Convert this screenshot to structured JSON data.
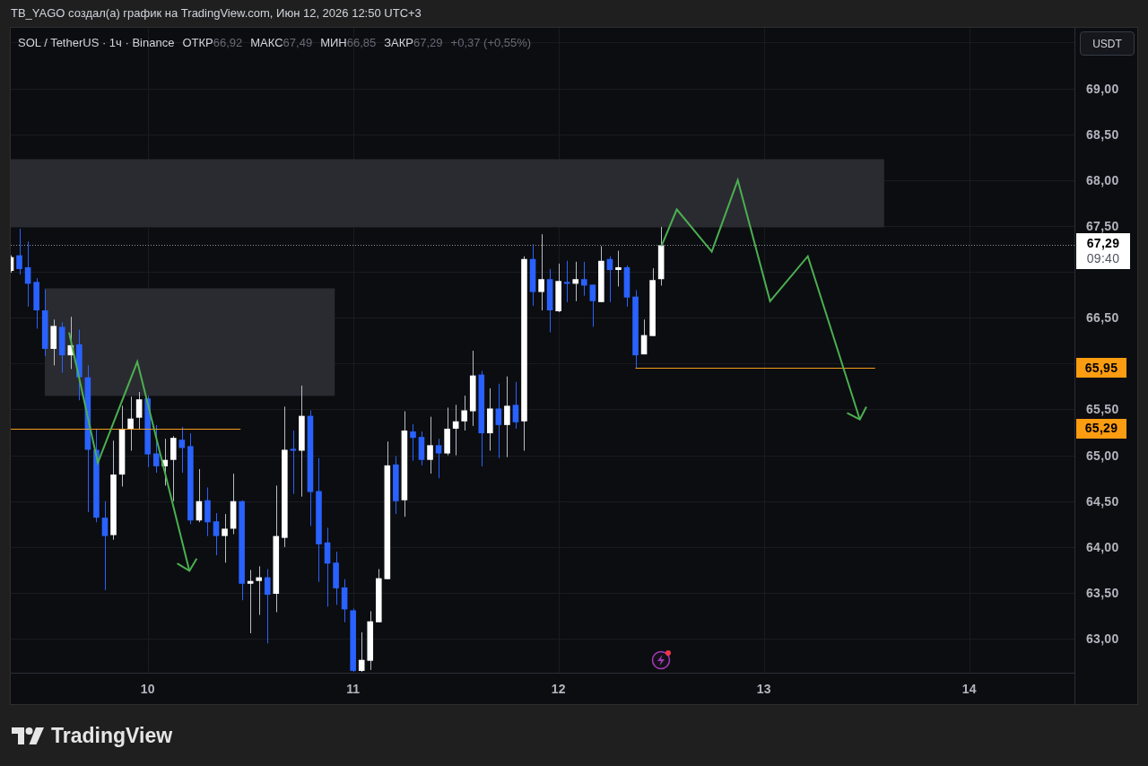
{
  "title": "TB_YAGO создал(а) график на TradingView.com, Июн 12, 2026 12:50 UTC+3",
  "chart": {
    "legend": {
      "symbol": "SOL / TetherUS · 1ч · Binance",
      "fields": [
        {
          "label": "ОТКР",
          "value": "66,92"
        },
        {
          "label": "МАКС",
          "value": "67,49"
        },
        {
          "label": "МИН",
          "value": "66,85"
        },
        {
          "label": "ЗАКР",
          "value": "67,29"
        }
      ],
      "change": "+0,37 (+0,55%)"
    },
    "currency_button": "USDT",
    "last_price_tag": {
      "price": "67,29",
      "countdown": "09:40"
    },
    "level_tags": [
      {
        "price": "65,95"
      },
      {
        "price": "65,29"
      }
    ],
    "drawings": [
      {
        "kind": "zone"
      },
      {
        "kind": "zone"
      },
      {
        "kind": "arrow_path",
        "arrow_head": true
      },
      {
        "kind": "arrow_path",
        "arrow_head": true
      }
    ],
    "chart_data": {
      "type": "candlestick",
      "xlim": [
        9.3333,
        14.5125
      ],
      "ylim": [
        62.63,
        69.66
      ],
      "xticks": [
        {
          "value": 10,
          "label": "10"
        },
        {
          "value": 11,
          "label": "11"
        },
        {
          "value": 12,
          "label": "12"
        },
        {
          "value": 13,
          "label": "13"
        },
        {
          "value": 14,
          "label": "14"
        }
      ],
      "yticks": [
        {
          "value": 63,
          "label": "63,00"
        },
        {
          "value": 63.5,
          "label": "63,50"
        },
        {
          "value": 64,
          "label": "64,00"
        },
        {
          "value": 64.5,
          "label": "64,50"
        },
        {
          "value": 65,
          "label": "65,00"
        },
        {
          "value": 65.5,
          "label": "65,50"
        },
        {
          "value": 66.5,
          "label": "66,50"
        },
        {
          "value": 67.5,
          "label": "67,50"
        },
        {
          "value": 68,
          "label": "68,00"
        },
        {
          "value": 68.5,
          "label": "68,50"
        },
        {
          "value": 69,
          "label": "69,00"
        }
      ],
      "x": [
        9.3333,
        9.375,
        9.4167,
        9.4583,
        9.5,
        9.5417,
        9.5833,
        9.625,
        9.6667,
        9.7083,
        9.75,
        9.7917,
        9.8333,
        9.875,
        9.9167,
        9.9583,
        10,
        10.0417,
        10.0833,
        10.125,
        10.1667,
        10.2083,
        10.25,
        10.2917,
        10.3333,
        10.375,
        10.4167,
        10.4583,
        10.5,
        10.5417,
        10.5833,
        10.625,
        10.6667,
        10.7083,
        10.75,
        10.7917,
        10.8333,
        10.875,
        10.9167,
        10.9583,
        11,
        11.0417,
        11.0833,
        11.125,
        11.1667,
        11.2083,
        11.25,
        11.2917,
        11.3333,
        11.375,
        11.4167,
        11.4583,
        11.5,
        11.5417,
        11.5833,
        11.625,
        11.6667,
        11.7083,
        11.75,
        11.7917,
        11.8333,
        11.875,
        11.9167,
        11.9583,
        12,
        12.0417,
        12.0833,
        12.125,
        12.1667,
        12.2083,
        12.25,
        12.2917,
        12.3333,
        12.375,
        12.4167,
        12.4583,
        12.5
      ],
      "ohlc": [
        [
          67.01,
          67.18,
          66.99,
          67.16
        ],
        [
          67.18,
          67.47,
          66.97,
          67.03
        ],
        [
          67.05,
          67.33,
          66.62,
          66.87
        ],
        [
          66.89,
          66.93,
          66.38,
          66.58
        ],
        [
          66.58,
          66.81,
          66.08,
          66.16
        ],
        [
          66.16,
          66.48,
          65.98,
          66.41
        ],
        [
          66.4,
          66.45,
          65.9,
          66.09
        ],
        [
          66.09,
          66.51,
          65.94,
          66.2
        ],
        [
          66.21,
          66.37,
          65.6,
          65.85
        ],
        [
          65.85,
          65.98,
          64.38,
          65.06
        ],
        [
          65.06,
          65.29,
          64.27,
          64.32
        ],
        [
          64.32,
          64.5,
          63.53,
          64.12
        ],
        [
          64.13,
          65.16,
          64.08,
          64.79
        ],
        [
          64.79,
          65.54,
          64.66,
          65.29
        ],
        [
          65.28,
          65.64,
          65.05,
          65.4
        ],
        [
          65.41,
          65.69,
          65.28,
          65.61
        ],
        [
          65.62,
          65.65,
          64.87,
          65.01
        ],
        [
          65.02,
          65.33,
          64.81,
          64.88
        ],
        [
          64.88,
          65.18,
          64.67,
          64.95
        ],
        [
          64.95,
          65.21,
          64.5,
          65.19
        ],
        [
          65.17,
          65.31,
          64.81,
          65.08
        ],
        [
          65.1,
          65.24,
          64.25,
          64.29
        ],
        [
          64.29,
          64.85,
          64.27,
          64.5
        ],
        [
          64.51,
          64.65,
          64.12,
          64.27
        ],
        [
          64.28,
          64.37,
          63.91,
          64.12
        ],
        [
          64.12,
          64.36,
          63.83,
          64.2
        ],
        [
          64.2,
          64.8,
          64.14,
          64.5
        ],
        [
          64.5,
          64.51,
          63.42,
          63.6
        ],
        [
          63.6,
          63.75,
          63.06,
          63.63
        ],
        [
          63.63,
          63.79,
          63.26,
          63.67
        ],
        [
          63.67,
          63.76,
          62.95,
          63.48
        ],
        [
          63.49,
          64.67,
          63.29,
          64.12
        ],
        [
          64.1,
          65.53,
          64.0,
          65.06
        ],
        [
          65.07,
          65.27,
          64.58,
          65.05
        ],
        [
          65.05,
          65.76,
          64.55,
          65.43
        ],
        [
          65.43,
          65.49,
          64.23,
          64.6
        ],
        [
          64.61,
          64.97,
          63.62,
          64.03
        ],
        [
          64.05,
          64.21,
          63.35,
          63.82
        ],
        [
          63.83,
          63.95,
          63.37,
          63.55
        ],
        [
          63.56,
          63.65,
          63.18,
          63.32
        ],
        [
          63.31,
          63.33,
          62.64,
          62.65
        ],
        [
          62.65,
          63.07,
          62.64,
          62.77
        ],
        [
          62.76,
          63.3,
          62.66,
          63.19
        ],
        [
          63.18,
          63.76,
          63.18,
          63.66
        ],
        [
          63.65,
          65.15,
          63.65,
          64.89
        ],
        [
          64.9,
          64.99,
          64.36,
          64.5
        ],
        [
          64.51,
          65.48,
          64.33,
          65.27
        ],
        [
          65.26,
          65.34,
          64.94,
          65.19
        ],
        [
          65.2,
          65.26,
          64.89,
          64.95
        ],
        [
          64.95,
          65.42,
          64.8,
          65.11
        ],
        [
          65.11,
          65.18,
          64.75,
          65.02
        ],
        [
          65.02,
          65.52,
          65.0,
          65.29
        ],
        [
          65.29,
          65.55,
          65.0,
          65.37
        ],
        [
          65.37,
          65.65,
          65.27,
          65.49
        ],
        [
          65.48,
          66.14,
          65.32,
          65.87
        ],
        [
          65.88,
          65.92,
          64.88,
          65.24
        ],
        [
          65.24,
          65.73,
          65.05,
          65.51
        ],
        [
          65.51,
          65.78,
          64.97,
          65.33
        ],
        [
          65.33,
          65.86,
          64.98,
          65.54
        ],
        [
          65.55,
          65.8,
          65.29,
          65.36
        ],
        [
          65.37,
          67.17,
          65.05,
          67.14
        ],
        [
          67.14,
          67.3,
          66.63,
          66.78
        ],
        [
          66.78,
          67.41,
          66.58,
          66.92
        ],
        [
          66.92,
          67.03,
          66.34,
          66.58
        ],
        [
          66.57,
          67.09,
          66.56,
          66.9
        ],
        [
          66.89,
          67.12,
          66.67,
          66.87
        ],
        [
          66.87,
          67.11,
          66.68,
          66.92
        ],
        [
          66.92,
          67.11,
          66.74,
          66.85
        ],
        [
          66.86,
          66.86,
          66.4,
          66.68
        ],
        [
          66.67,
          67.28,
          66.67,
          67.12
        ],
        [
          67.14,
          67.17,
          66.67,
          67.02
        ],
        [
          67.02,
          67.23,
          66.84,
          67.05
        ],
        [
          67.05,
          67.07,
          66.62,
          66.72
        ],
        [
          66.73,
          66.8,
          65.95,
          66.09
        ],
        [
          66.1,
          66.48,
          66.1,
          66.31
        ],
        [
          66.3,
          67.04,
          66.3,
          66.91
        ],
        [
          66.92,
          67.49,
          66.85,
          67.29
        ]
      ],
      "ref_lines": [
        {
          "axis": "y",
          "value": 65.95
        },
        {
          "axis": "y",
          "value": 65.29
        }
      ]
    }
  },
  "footer": {
    "logo_text": "TradingView"
  }
}
